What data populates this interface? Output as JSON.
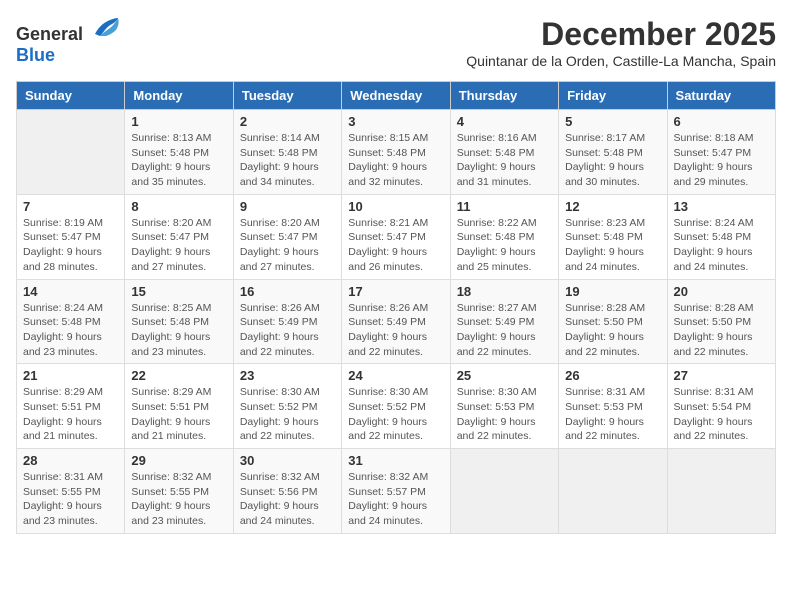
{
  "logo": {
    "general": "General",
    "blue": "Blue"
  },
  "title": "December 2025",
  "subtitle": "Quintanar de la Orden, Castille-La Mancha, Spain",
  "headers": [
    "Sunday",
    "Monday",
    "Tuesday",
    "Wednesday",
    "Thursday",
    "Friday",
    "Saturday"
  ],
  "weeks": [
    [
      {
        "day": "",
        "sunrise": "",
        "sunset": "",
        "daylight": ""
      },
      {
        "day": "1",
        "sunrise": "Sunrise: 8:13 AM",
        "sunset": "Sunset: 5:48 PM",
        "daylight": "Daylight: 9 hours and 35 minutes."
      },
      {
        "day": "2",
        "sunrise": "Sunrise: 8:14 AM",
        "sunset": "Sunset: 5:48 PM",
        "daylight": "Daylight: 9 hours and 34 minutes."
      },
      {
        "day": "3",
        "sunrise": "Sunrise: 8:15 AM",
        "sunset": "Sunset: 5:48 PM",
        "daylight": "Daylight: 9 hours and 32 minutes."
      },
      {
        "day": "4",
        "sunrise": "Sunrise: 8:16 AM",
        "sunset": "Sunset: 5:48 PM",
        "daylight": "Daylight: 9 hours and 31 minutes."
      },
      {
        "day": "5",
        "sunrise": "Sunrise: 8:17 AM",
        "sunset": "Sunset: 5:48 PM",
        "daylight": "Daylight: 9 hours and 30 minutes."
      },
      {
        "day": "6",
        "sunrise": "Sunrise: 8:18 AM",
        "sunset": "Sunset: 5:47 PM",
        "daylight": "Daylight: 9 hours and 29 minutes."
      }
    ],
    [
      {
        "day": "7",
        "sunrise": "Sunrise: 8:19 AM",
        "sunset": "Sunset: 5:47 PM",
        "daylight": "Daylight: 9 hours and 28 minutes."
      },
      {
        "day": "8",
        "sunrise": "Sunrise: 8:20 AM",
        "sunset": "Sunset: 5:47 PM",
        "daylight": "Daylight: 9 hours and 27 minutes."
      },
      {
        "day": "9",
        "sunrise": "Sunrise: 8:20 AM",
        "sunset": "Sunset: 5:47 PM",
        "daylight": "Daylight: 9 hours and 27 minutes."
      },
      {
        "day": "10",
        "sunrise": "Sunrise: 8:21 AM",
        "sunset": "Sunset: 5:47 PM",
        "daylight": "Daylight: 9 hours and 26 minutes."
      },
      {
        "day": "11",
        "sunrise": "Sunrise: 8:22 AM",
        "sunset": "Sunset: 5:48 PM",
        "daylight": "Daylight: 9 hours and 25 minutes."
      },
      {
        "day": "12",
        "sunrise": "Sunrise: 8:23 AM",
        "sunset": "Sunset: 5:48 PM",
        "daylight": "Daylight: 9 hours and 24 minutes."
      },
      {
        "day": "13",
        "sunrise": "Sunrise: 8:24 AM",
        "sunset": "Sunset: 5:48 PM",
        "daylight": "Daylight: 9 hours and 24 minutes."
      }
    ],
    [
      {
        "day": "14",
        "sunrise": "Sunrise: 8:24 AM",
        "sunset": "Sunset: 5:48 PM",
        "daylight": "Daylight: 9 hours and 23 minutes."
      },
      {
        "day": "15",
        "sunrise": "Sunrise: 8:25 AM",
        "sunset": "Sunset: 5:48 PM",
        "daylight": "Daylight: 9 hours and 23 minutes."
      },
      {
        "day": "16",
        "sunrise": "Sunrise: 8:26 AM",
        "sunset": "Sunset: 5:49 PM",
        "daylight": "Daylight: 9 hours and 22 minutes."
      },
      {
        "day": "17",
        "sunrise": "Sunrise: 8:26 AM",
        "sunset": "Sunset: 5:49 PM",
        "daylight": "Daylight: 9 hours and 22 minutes."
      },
      {
        "day": "18",
        "sunrise": "Sunrise: 8:27 AM",
        "sunset": "Sunset: 5:49 PM",
        "daylight": "Daylight: 9 hours and 22 minutes."
      },
      {
        "day": "19",
        "sunrise": "Sunrise: 8:28 AM",
        "sunset": "Sunset: 5:50 PM",
        "daylight": "Daylight: 9 hours and 22 minutes."
      },
      {
        "day": "20",
        "sunrise": "Sunrise: 8:28 AM",
        "sunset": "Sunset: 5:50 PM",
        "daylight": "Daylight: 9 hours and 22 minutes."
      }
    ],
    [
      {
        "day": "21",
        "sunrise": "Sunrise: 8:29 AM",
        "sunset": "Sunset: 5:51 PM",
        "daylight": "Daylight: 9 hours and 21 minutes."
      },
      {
        "day": "22",
        "sunrise": "Sunrise: 8:29 AM",
        "sunset": "Sunset: 5:51 PM",
        "daylight": "Daylight: 9 hours and 21 minutes."
      },
      {
        "day": "23",
        "sunrise": "Sunrise: 8:30 AM",
        "sunset": "Sunset: 5:52 PM",
        "daylight": "Daylight: 9 hours and 22 minutes."
      },
      {
        "day": "24",
        "sunrise": "Sunrise: 8:30 AM",
        "sunset": "Sunset: 5:52 PM",
        "daylight": "Daylight: 9 hours and 22 minutes."
      },
      {
        "day": "25",
        "sunrise": "Sunrise: 8:30 AM",
        "sunset": "Sunset: 5:53 PM",
        "daylight": "Daylight: 9 hours and 22 minutes."
      },
      {
        "day": "26",
        "sunrise": "Sunrise: 8:31 AM",
        "sunset": "Sunset: 5:53 PM",
        "daylight": "Daylight: 9 hours and 22 minutes."
      },
      {
        "day": "27",
        "sunrise": "Sunrise: 8:31 AM",
        "sunset": "Sunset: 5:54 PM",
        "daylight": "Daylight: 9 hours and 22 minutes."
      }
    ],
    [
      {
        "day": "28",
        "sunrise": "Sunrise: 8:31 AM",
        "sunset": "Sunset: 5:55 PM",
        "daylight": "Daylight: 9 hours and 23 minutes."
      },
      {
        "day": "29",
        "sunrise": "Sunrise: 8:32 AM",
        "sunset": "Sunset: 5:55 PM",
        "daylight": "Daylight: 9 hours and 23 minutes."
      },
      {
        "day": "30",
        "sunrise": "Sunrise: 8:32 AM",
        "sunset": "Sunset: 5:56 PM",
        "daylight": "Daylight: 9 hours and 24 minutes."
      },
      {
        "day": "31",
        "sunrise": "Sunrise: 8:32 AM",
        "sunset": "Sunset: 5:57 PM",
        "daylight": "Daylight: 9 hours and 24 minutes."
      },
      {
        "day": "",
        "sunrise": "",
        "sunset": "",
        "daylight": ""
      },
      {
        "day": "",
        "sunrise": "",
        "sunset": "",
        "daylight": ""
      },
      {
        "day": "",
        "sunrise": "",
        "sunset": "",
        "daylight": ""
      }
    ]
  ]
}
